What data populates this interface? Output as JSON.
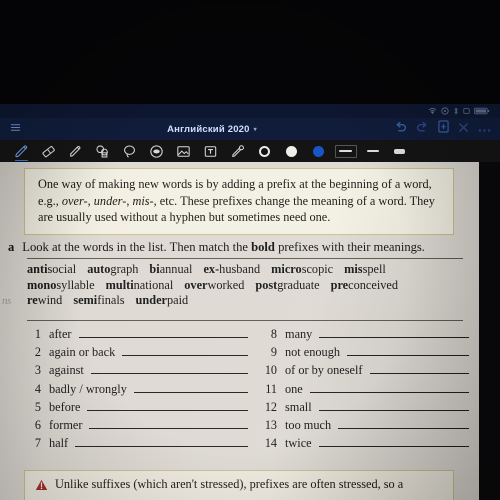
{
  "status_bar": {
    "icons": [
      "wifi-icon",
      "settings-icon",
      "bluetooth-icon",
      "sync-icon",
      "battery-icon"
    ]
  },
  "app_header": {
    "menu_icon": "hamburger-icon",
    "title": "Английский 2020",
    "title_caret": "▾",
    "actions": [
      {
        "name": "undo-button",
        "glyph": "↺"
      },
      {
        "name": "redo-button",
        "glyph": "↻"
      },
      {
        "name": "document-button",
        "glyph": "🗎"
      },
      {
        "name": "close-button",
        "glyph": "✕"
      },
      {
        "name": "more-button",
        "glyph": "•••"
      }
    ]
  },
  "pen_toolbar": {
    "tools": [
      {
        "name": "pen-tool",
        "selected": true
      },
      {
        "name": "eraser-tool",
        "selected": false
      },
      {
        "name": "highlighter-tool",
        "selected": false
      },
      {
        "name": "shapes-tool",
        "selected": false
      },
      {
        "name": "lasso-tool",
        "selected": false
      },
      {
        "name": "ellipse-tool",
        "selected": false
      },
      {
        "name": "image-tool",
        "selected": false
      },
      {
        "name": "text-tool",
        "selected": false
      },
      {
        "name": "eyedropper-tool",
        "selected": false
      }
    ],
    "colors": [
      {
        "name": "color-swatch-black",
        "hex": "#111111"
      },
      {
        "name": "color-swatch-white",
        "hex": "#eeeeea"
      },
      {
        "name": "color-swatch-blue",
        "hex": "#1a55c8"
      }
    ],
    "strokes": [
      {
        "name": "stroke-width-thin",
        "px": 1.5
      },
      {
        "name": "stroke-width-medium",
        "px": 2.5
      },
      {
        "name": "stroke-width-thick",
        "px": 4
      }
    ]
  },
  "page": {
    "intro_callout": {
      "line1_a": "One way of making new words is by adding a prefix at the beginning of a word, e.g., ",
      "em1": "over-",
      "sep1": ", ",
      "em2": "under-",
      "sep2": ", ",
      "em3": "mis-",
      "line1_b": ", etc. These prefixes change the meaning of a word. They are usually used without a hyphen but sometimes need one."
    },
    "exercise": {
      "letter": "a",
      "instruction_pre": "Look at the words in the list. Then match the ",
      "instruction_bold": "bold",
      "instruction_post": " prefixes with their meanings."
    },
    "word_bank": [
      [
        {
          "bold": "anti",
          "rest": "social"
        },
        {
          "bold": "auto",
          "rest": "graph"
        },
        {
          "bold": "bi",
          "rest": "annual"
        },
        {
          "bold": "ex-",
          "rest": "husband"
        },
        {
          "bold": "micro",
          "rest": "scopic"
        },
        {
          "bold": "mis",
          "rest": "spell"
        }
      ],
      [
        {
          "bold": "mono",
          "rest": "syllable"
        },
        {
          "bold": "multi",
          "rest": "national"
        },
        {
          "bold": "over",
          "rest": "worked"
        },
        {
          "bold": "post",
          "rest": "graduate"
        },
        {
          "bold": "pre",
          "rest": "conceived"
        }
      ],
      [
        {
          "bold": "re",
          "rest": "wind"
        },
        {
          "bold": "semi",
          "rest": "finals"
        },
        {
          "bold": "under",
          "rest": "paid"
        }
      ]
    ],
    "margin_scribble": "ns",
    "answers_left": [
      {
        "num": "1",
        "label": "after",
        "answer": ""
      },
      {
        "num": "2",
        "label": "again or back",
        "answer": ""
      },
      {
        "num": "3",
        "label": "against",
        "answer": ""
      },
      {
        "num": "4",
        "label": "badly / wrongly",
        "answer": ""
      },
      {
        "num": "5",
        "label": "before",
        "answer": ""
      },
      {
        "num": "6",
        "label": "former",
        "answer": ""
      },
      {
        "num": "7",
        "label": "half",
        "answer": ""
      }
    ],
    "answers_right": [
      {
        "num": "8",
        "label": "many",
        "answer": ""
      },
      {
        "num": "9",
        "label": "not enough",
        "answer": ""
      },
      {
        "num": "10",
        "label": "of or by oneself",
        "answer": ""
      },
      {
        "num": "11",
        "label": "one",
        "answer": ""
      },
      {
        "num": "12",
        "label": "small",
        "answer": ""
      },
      {
        "num": "13",
        "label": "too much",
        "answer": ""
      },
      {
        "num": "14",
        "label": "twice",
        "answer": ""
      }
    ],
    "warning_callout": {
      "icon": "warning-triangle-icon",
      "text": "Unlike suffixes (which aren't stressed), prefixes are often stressed, so a"
    }
  },
  "colors": {
    "header_blue": "#101c3a",
    "toolbar_black": "#141414",
    "paper": "#ddd9d2",
    "callout_bg": "#f2efe2",
    "callout_border": "#c9c08a",
    "accent_blue": "#3b6fd8",
    "warning_red": "#a32020"
  }
}
